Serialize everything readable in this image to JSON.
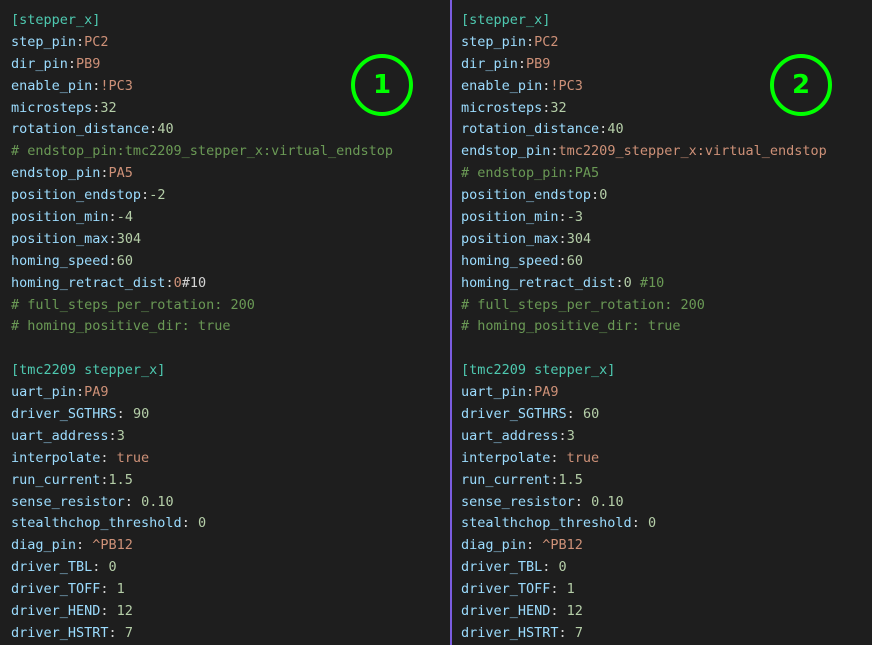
{
  "colors": {
    "background": "#1e1e1e",
    "divider": "#7b5ce0",
    "badge": "#00ff00",
    "key": "#9cdcfe",
    "section": "#4ec9b0",
    "value_string": "#ce9178",
    "value_number": "#b5cea8",
    "value_keyword": "#ce9178",
    "comment": "#6a9955",
    "punct": "#d4d4d4"
  },
  "badges": [
    {
      "label": "1"
    },
    {
      "label": "2"
    }
  ],
  "panes": [
    {
      "lines": [
        [
          {
            "t": "[stepper_x]",
            "c": "section"
          }
        ],
        [
          {
            "t": "step_pin",
            "c": "key"
          },
          {
            "t": ":",
            "c": "punct"
          },
          {
            "t": "PC2",
            "c": "value_string"
          }
        ],
        [
          {
            "t": "dir_pin",
            "c": "key"
          },
          {
            "t": ":",
            "c": "punct"
          },
          {
            "t": "PB9",
            "c": "value_string"
          }
        ],
        [
          {
            "t": "enable_pin",
            "c": "key"
          },
          {
            "t": ":",
            "c": "punct"
          },
          {
            "t": "!PC3",
            "c": "value_string"
          }
        ],
        [
          {
            "t": "microsteps",
            "c": "key"
          },
          {
            "t": ":",
            "c": "punct"
          },
          {
            "t": "32",
            "c": "value_number"
          }
        ],
        [
          {
            "t": "rotation_distance",
            "c": "key"
          },
          {
            "t": ":",
            "c": "punct"
          },
          {
            "t": "40",
            "c": "value_number"
          }
        ],
        [
          {
            "t": "# endstop_pin:tmc2209_stepper_x:virtual_endstop",
            "c": "comment"
          }
        ],
        [
          {
            "t": "endstop_pin",
            "c": "key"
          },
          {
            "t": ":",
            "c": "punct"
          },
          {
            "t": "PA5",
            "c": "value_string"
          }
        ],
        [
          {
            "t": "position_endstop",
            "c": "key"
          },
          {
            "t": ":",
            "c": "punct"
          },
          {
            "t": "-2",
            "c": "value_number"
          }
        ],
        [
          {
            "t": "position_min",
            "c": "key"
          },
          {
            "t": ":",
            "c": "punct"
          },
          {
            "t": "-4",
            "c": "value_number"
          }
        ],
        [
          {
            "t": "position_max",
            "c": "key"
          },
          {
            "t": ":",
            "c": "punct"
          },
          {
            "t": "304",
            "c": "value_number"
          }
        ],
        [
          {
            "t": "homing_speed",
            "c": "key"
          },
          {
            "t": ":",
            "c": "punct"
          },
          {
            "t": "60",
            "c": "value_number"
          }
        ],
        [
          {
            "t": "homing_retract_dist",
            "c": "key"
          },
          {
            "t": ":",
            "c": "punct"
          },
          {
            "t": "0",
            "c": "value_string"
          },
          {
            "t": "#10",
            "c": "punct"
          }
        ],
        [
          {
            "t": "# full_steps_per_rotation: 200",
            "c": "comment"
          }
        ],
        [
          {
            "t": "# homing_positive_dir: true",
            "c": "comment"
          }
        ],
        [],
        [
          {
            "t": "[tmc2209 stepper_x]",
            "c": "section"
          }
        ],
        [
          {
            "t": "uart_pin",
            "c": "key"
          },
          {
            "t": ":",
            "c": "punct"
          },
          {
            "t": "PA9",
            "c": "value_string"
          }
        ],
        [
          {
            "t": "driver_SGTHRS",
            "c": "key"
          },
          {
            "t": ": ",
            "c": "punct"
          },
          {
            "t": "90",
            "c": "value_number"
          }
        ],
        [
          {
            "t": "uart_address",
            "c": "key"
          },
          {
            "t": ":",
            "c": "punct"
          },
          {
            "t": "3",
            "c": "value_number"
          }
        ],
        [
          {
            "t": "interpolate",
            "c": "key"
          },
          {
            "t": ": ",
            "c": "punct"
          },
          {
            "t": "true",
            "c": "value_keyword"
          }
        ],
        [
          {
            "t": "run_current",
            "c": "key"
          },
          {
            "t": ":",
            "c": "punct"
          },
          {
            "t": "1.5",
            "c": "value_number"
          }
        ],
        [
          {
            "t": "sense_resistor",
            "c": "key"
          },
          {
            "t": ": ",
            "c": "punct"
          },
          {
            "t": "0.10",
            "c": "value_number"
          }
        ],
        [
          {
            "t": "stealthchop_threshold",
            "c": "key"
          },
          {
            "t": ": ",
            "c": "punct"
          },
          {
            "t": "0",
            "c": "value_number"
          }
        ],
        [
          {
            "t": "diag_pin",
            "c": "key"
          },
          {
            "t": ": ",
            "c": "punct"
          },
          {
            "t": "^PB12",
            "c": "value_string"
          }
        ],
        [
          {
            "t": "driver_TBL",
            "c": "key"
          },
          {
            "t": ": ",
            "c": "punct"
          },
          {
            "t": "0",
            "c": "value_number"
          }
        ],
        [
          {
            "t": "driver_TOFF",
            "c": "key"
          },
          {
            "t": ": ",
            "c": "punct"
          },
          {
            "t": "1",
            "c": "value_number"
          }
        ],
        [
          {
            "t": "driver_HEND",
            "c": "key"
          },
          {
            "t": ": ",
            "c": "punct"
          },
          {
            "t": "12",
            "c": "value_number"
          }
        ],
        [
          {
            "t": "driver_HSTRT",
            "c": "key"
          },
          {
            "t": ": ",
            "c": "punct"
          },
          {
            "t": "7",
            "c": "value_number"
          }
        ]
      ]
    },
    {
      "lines": [
        [
          {
            "t": "[stepper_x]",
            "c": "section"
          }
        ],
        [
          {
            "t": "step_pin",
            "c": "key"
          },
          {
            "t": ":",
            "c": "punct"
          },
          {
            "t": "PC2",
            "c": "value_string"
          }
        ],
        [
          {
            "t": "dir_pin",
            "c": "key"
          },
          {
            "t": ":",
            "c": "punct"
          },
          {
            "t": "PB9",
            "c": "value_string"
          }
        ],
        [
          {
            "t": "enable_pin",
            "c": "key"
          },
          {
            "t": ":",
            "c": "punct"
          },
          {
            "t": "!PC3",
            "c": "value_string"
          }
        ],
        [
          {
            "t": "microsteps",
            "c": "key"
          },
          {
            "t": ":",
            "c": "punct"
          },
          {
            "t": "32",
            "c": "value_number"
          }
        ],
        [
          {
            "t": "rotation_distance",
            "c": "key"
          },
          {
            "t": ":",
            "c": "punct"
          },
          {
            "t": "40",
            "c": "value_number"
          }
        ],
        [
          {
            "t": "endstop_pin",
            "c": "key"
          },
          {
            "t": ":",
            "c": "punct"
          },
          {
            "t": "tmc2209_stepper_x:virtual_endstop",
            "c": "value_string"
          }
        ],
        [
          {
            "t": "# endstop_pin:PA5",
            "c": "comment"
          }
        ],
        [
          {
            "t": "position_endstop",
            "c": "key"
          },
          {
            "t": ":",
            "c": "punct"
          },
          {
            "t": "0",
            "c": "value_number"
          }
        ],
        [
          {
            "t": "position_min",
            "c": "key"
          },
          {
            "t": ":",
            "c": "punct"
          },
          {
            "t": "-3",
            "c": "value_number"
          }
        ],
        [
          {
            "t": "position_max",
            "c": "key"
          },
          {
            "t": ":",
            "c": "punct"
          },
          {
            "t": "304",
            "c": "value_number"
          }
        ],
        [
          {
            "t": "homing_speed",
            "c": "key"
          },
          {
            "t": ":",
            "c": "punct"
          },
          {
            "t": "60",
            "c": "value_number"
          }
        ],
        [
          {
            "t": "homing_retract_dist",
            "c": "key"
          },
          {
            "t": ":",
            "c": "punct"
          },
          {
            "t": "0",
            "c": "value_number"
          },
          {
            "t": " #10",
            "c": "comment"
          }
        ],
        [
          {
            "t": "# full_steps_per_rotation: 200",
            "c": "comment"
          }
        ],
        [
          {
            "t": "# homing_positive_dir: true",
            "c": "comment"
          }
        ],
        [],
        [
          {
            "t": "[tmc2209 stepper_x]",
            "c": "section"
          }
        ],
        [
          {
            "t": "uart_pin",
            "c": "key"
          },
          {
            "t": ":",
            "c": "punct"
          },
          {
            "t": "PA9",
            "c": "value_string"
          }
        ],
        [
          {
            "t": "driver_SGTHRS",
            "c": "key"
          },
          {
            "t": ": ",
            "c": "punct"
          },
          {
            "t": "60",
            "c": "value_number"
          }
        ],
        [
          {
            "t": "uart_address",
            "c": "key"
          },
          {
            "t": ":",
            "c": "punct"
          },
          {
            "t": "3",
            "c": "value_number"
          }
        ],
        [
          {
            "t": "interpolate",
            "c": "key"
          },
          {
            "t": ": ",
            "c": "punct"
          },
          {
            "t": "true",
            "c": "value_keyword"
          }
        ],
        [
          {
            "t": "run_current",
            "c": "key"
          },
          {
            "t": ":",
            "c": "punct"
          },
          {
            "t": "1.5",
            "c": "value_number"
          }
        ],
        [
          {
            "t": "sense_resistor",
            "c": "key"
          },
          {
            "t": ": ",
            "c": "punct"
          },
          {
            "t": "0.10",
            "c": "value_number"
          }
        ],
        [
          {
            "t": "stealthchop_threshold",
            "c": "key"
          },
          {
            "t": ": ",
            "c": "punct"
          },
          {
            "t": "0",
            "c": "value_number"
          }
        ],
        [
          {
            "t": "diag_pin",
            "c": "key"
          },
          {
            "t": ": ",
            "c": "punct"
          },
          {
            "t": "^PB12",
            "c": "value_string"
          }
        ],
        [
          {
            "t": "driver_TBL",
            "c": "key"
          },
          {
            "t": ": ",
            "c": "punct"
          },
          {
            "t": "0",
            "c": "value_number"
          }
        ],
        [
          {
            "t": "driver_TOFF",
            "c": "key"
          },
          {
            "t": ": ",
            "c": "punct"
          },
          {
            "t": "1",
            "c": "value_number"
          }
        ],
        [
          {
            "t": "driver_HEND",
            "c": "key"
          },
          {
            "t": ": ",
            "c": "punct"
          },
          {
            "t": "12",
            "c": "value_number"
          }
        ],
        [
          {
            "t": "driver_HSTRT",
            "c": "key"
          },
          {
            "t": ": ",
            "c": "punct"
          },
          {
            "t": "7",
            "c": "value_number"
          }
        ]
      ]
    }
  ]
}
